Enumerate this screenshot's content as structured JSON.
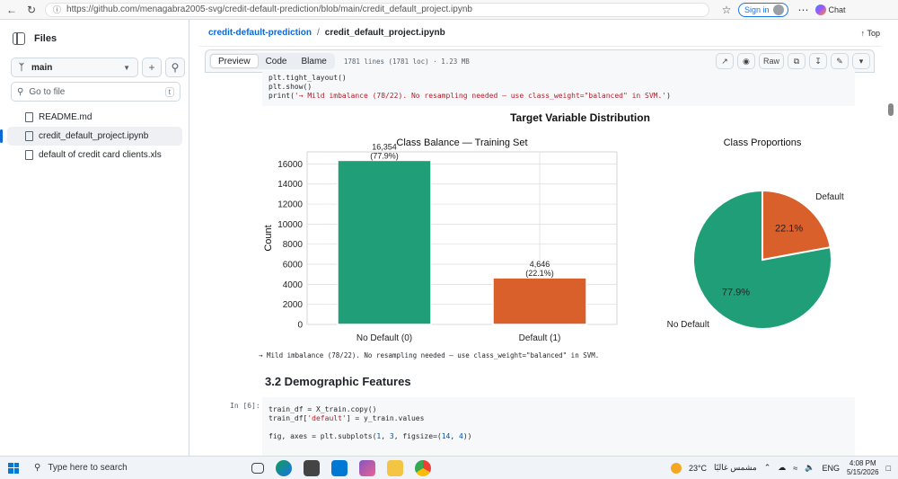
{
  "browser": {
    "url": "https://github.com/menagabra2005-svg/credit-default-prediction/blob/main/credit_default_project.ipynb",
    "signin_label": "Sign in",
    "chat_label": "Chat"
  },
  "sidebar": {
    "title": "Files",
    "branch": "main",
    "goto_placeholder": "Go to file",
    "goto_key": "t",
    "files": [
      "README.md",
      "credit_default_project.ipynb",
      "default of credit card clients.xls"
    ]
  },
  "header": {
    "repo": "credit-default-prediction",
    "separator": "/",
    "file": "credit_default_project.ipynb",
    "top_label": "Top"
  },
  "toolbar": {
    "tabs": [
      "Preview",
      "Code",
      "Blame"
    ],
    "meta": "1781 lines (1781 loc) · 1.23 MB",
    "raw_label": "Raw"
  },
  "code_top": {
    "line1": "plt.tight_layout()",
    "line2": "plt.show()",
    "line3_prefix": "print(",
    "line3_str": "'→ Mild imbalance (78/22). No resampling needed — use class_weight=\"balanced\" in SVM.'",
    "line3_suffix": ")"
  },
  "chart_data": [
    {
      "type": "bar",
      "suptitle": "Target Variable Distribution",
      "title": "Class Balance — Training Set",
      "categories": [
        "No Default (0)",
        "Default (1)"
      ],
      "values": [
        16354,
        4646
      ],
      "data_labels": [
        "16,354\n(77.9%)",
        "4,646\n(22.1%)"
      ],
      "colors": [
        "#1f9e77",
        "#d95f2b"
      ],
      "ylabel": "Count",
      "yticks": [
        0,
        2000,
        4000,
        6000,
        8000,
        10000,
        12000,
        14000,
        16000
      ],
      "ylim": [
        0,
        17200
      ],
      "grid": true
    },
    {
      "type": "pie",
      "title": "Class Proportions",
      "labels": [
        "No Default",
        "Default"
      ],
      "values": [
        77.9,
        22.1
      ],
      "pct_labels": [
        "77.9%",
        "22.1%"
      ],
      "colors": [
        "#1f9e77",
        "#d95f2b"
      ]
    }
  ],
  "output": {
    "text": "→ Mild imbalance (78/22). No resampling needed — use class_weight=\"balanced\" in SVM."
  },
  "section": {
    "heading": "3.2 Demographic Features"
  },
  "cell": {
    "in_label": "In [6]:",
    "lines": [
      "train_df = X_train.copy()",
      "train_df['default'] = y_train.values",
      "",
      "fig, axes = plt.subplots(1, 3, figsize=(14, 4))"
    ]
  },
  "taskbar": {
    "search_placeholder": "Type here to search",
    "weather_temp": "23°C",
    "weather_desc": "مشمس غالبًا",
    "lang": "ENG",
    "time": "4:08 PM",
    "date": "5/15/2026"
  }
}
